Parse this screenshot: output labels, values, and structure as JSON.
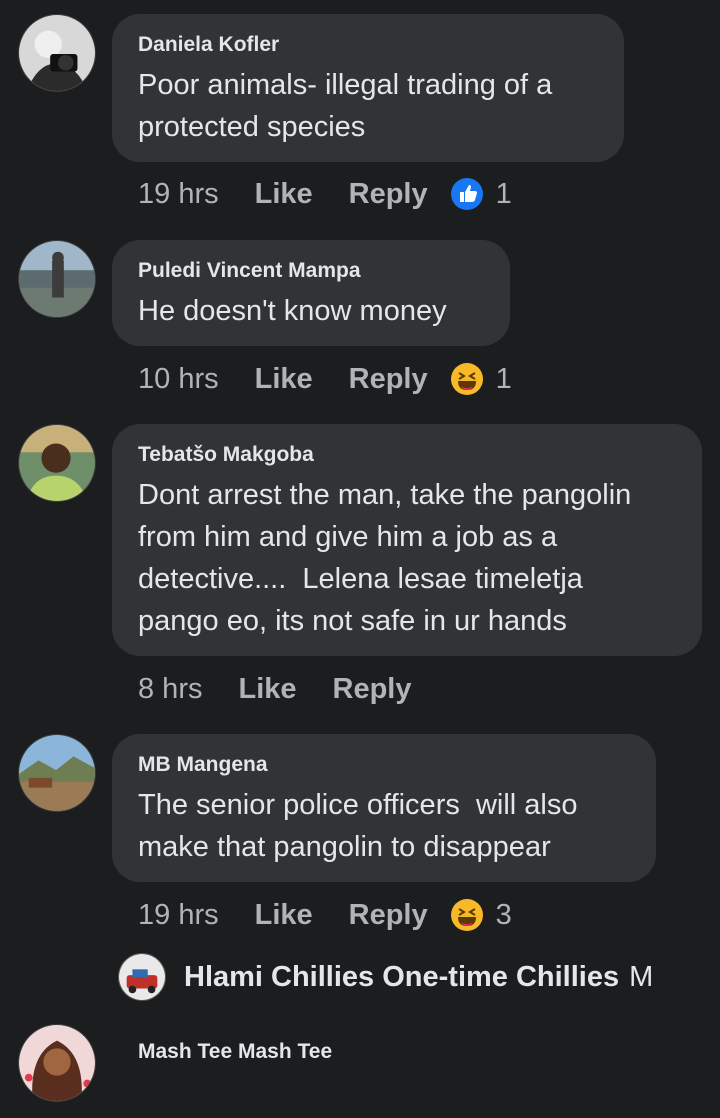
{
  "comments": [
    {
      "author": "Daniela Kofler",
      "text": "Poor animals- illegal trading of a\nprotected species",
      "time": "19 hrs",
      "like": "Like",
      "reply": "Reply",
      "reaction": "like",
      "reaction_count": "1"
    },
    {
      "author": "Puledi Vincent Mampa",
      "text": "He doesn't know money",
      "time": "10 hrs",
      "like": "Like",
      "reply": "Reply",
      "reaction": "haha",
      "reaction_count": "1"
    },
    {
      "author": "Tebatšo Makgoba",
      "text": "Dont arrest the man, take the pangolin\nfrom him and give him a job as a\ndetective....  Lelena lesae timeletja\npango eo, its not safe in ur hands",
      "time": "8 hrs",
      "like": "Like",
      "reply": "Reply"
    },
    {
      "author": "MB Mangena",
      "text": "The senior police officers  will also\nmake that pangolin to disappear",
      "time": "19 hrs",
      "like": "Like",
      "reply": "Reply",
      "reaction": "haha",
      "reaction_count": "3"
    }
  ],
  "reply_preview": {
    "author": "Hlami Chillies One-time Chillies",
    "cut_text": "M"
  },
  "last_comment": {
    "author": "Mash Tee Mash Tee"
  },
  "colors": {
    "background": "#1c1d1f",
    "bubble": "#323335",
    "like_blue": "#1877f2",
    "haha_yellow": "#f7b928"
  }
}
